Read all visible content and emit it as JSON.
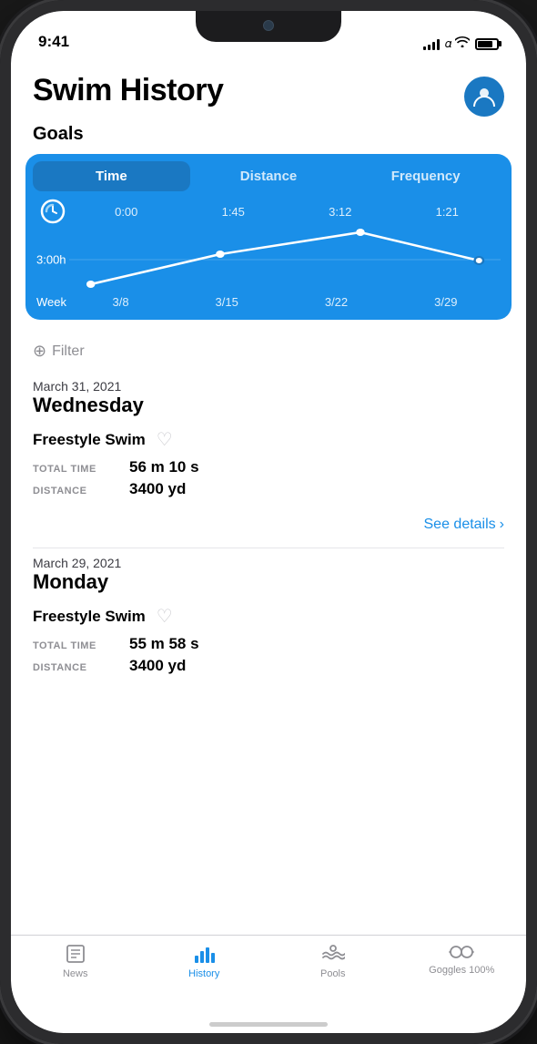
{
  "status_bar": {
    "time": "9:41",
    "signal_bars": [
      4,
      6,
      8,
      10,
      12
    ],
    "wifi": "wifi",
    "battery": 80
  },
  "header": {
    "title": "Swim History",
    "profile_icon": "👤"
  },
  "goals": {
    "section_label": "Goals",
    "tabs": [
      "Time",
      "Distance",
      "Frequency"
    ],
    "active_tab": 0,
    "chart": {
      "values": [
        "0:00",
        "1:45",
        "3:12",
        "1:21"
      ],
      "x_labels": [
        "3/8",
        "3/15",
        "3/22",
        "3/29"
      ],
      "y_label": "3:00h",
      "week_label": "Week"
    }
  },
  "filter": {
    "icon": "⊕",
    "label": "Filter"
  },
  "entries": [
    {
      "date": "March 31, 2021",
      "day": "Wednesday",
      "workouts": [
        {
          "title": "Freestyle Swim",
          "stats": [
            {
              "label": "TOTAL TIME",
              "value": "56 m 10 s"
            },
            {
              "label": "DISTANCE",
              "value": "3400 yd"
            }
          ]
        }
      ],
      "see_details": "See details"
    },
    {
      "date": "March 29, 2021",
      "day": "Monday",
      "workouts": [
        {
          "title": "Freestyle Swim",
          "stats": [
            {
              "label": "TOTAL TIME",
              "value": "55 m 58 s"
            },
            {
              "label": "DISTANCE",
              "value": "3400 yd"
            }
          ]
        }
      ],
      "see_details": null
    }
  ],
  "tab_bar": {
    "items": [
      {
        "label": "News",
        "icon": "📰",
        "active": false
      },
      {
        "label": "History",
        "icon": "📊",
        "active": true
      },
      {
        "label": "Pools",
        "icon": "🏊",
        "active": false
      },
      {
        "label": "Goggles 100%",
        "icon": "🥽",
        "active": false
      }
    ]
  }
}
